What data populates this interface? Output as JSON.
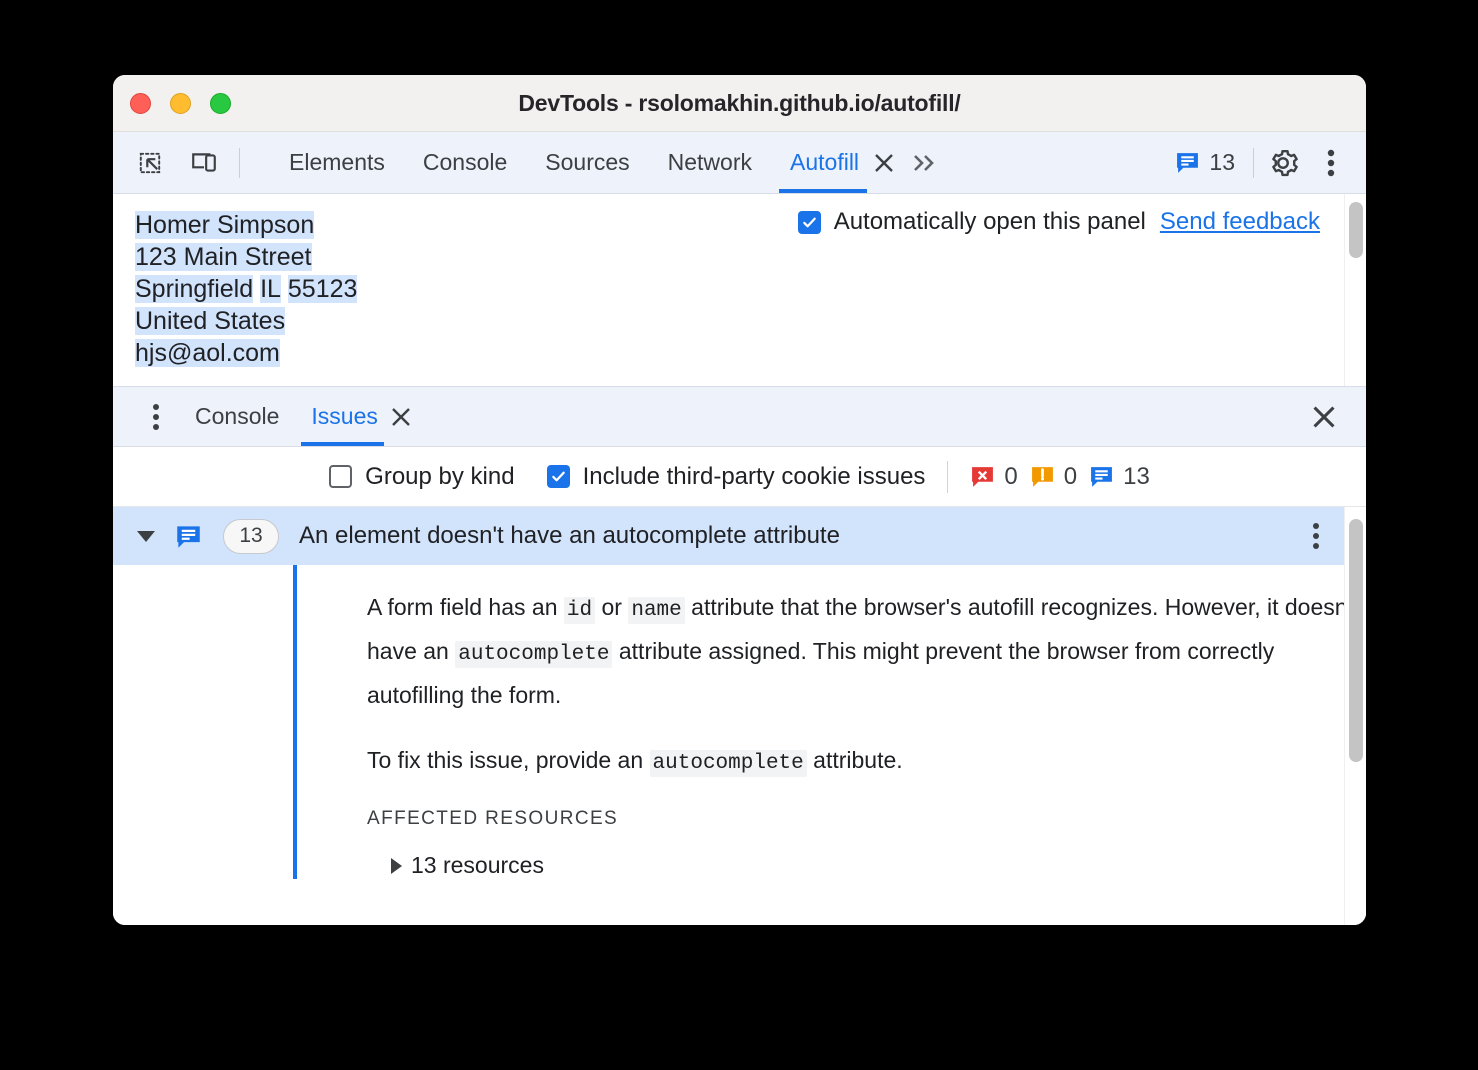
{
  "window": {
    "title": "DevTools - rsolomakhin.github.io/autofill/",
    "traffic_lights": [
      "close",
      "minimize",
      "zoom"
    ],
    "colors": {
      "accent": "#1a73e8",
      "selection": "#d2e3fc",
      "error": "#e53935",
      "warning": "#f29900",
      "info": "#1a73e8",
      "titlebar": "#f2f1ef",
      "toolbar": "#eef2fb"
    }
  },
  "toolbar": {
    "inspect_icon": "inspect-element-icon",
    "device_icon": "device-toolbar-icon",
    "tabs": [
      {
        "label": "Elements",
        "active": false,
        "closable": false
      },
      {
        "label": "Console",
        "active": false,
        "closable": false
      },
      {
        "label": "Sources",
        "active": false,
        "closable": false
      },
      {
        "label": "Network",
        "active": false,
        "closable": false
      },
      {
        "label": "Autofill",
        "active": true,
        "closable": true
      }
    ],
    "overflow_label": "»",
    "issue_count": "13",
    "settings_icon": "gear-icon",
    "more_icon": "more-options-icon"
  },
  "autofill_panel": {
    "address_lines": [
      {
        "text": "Homer Simpson",
        "segments": [
          {
            "text": "Homer Simpson",
            "highlighted": true
          }
        ]
      },
      {
        "text": "123 Main Street",
        "segments": [
          {
            "text": "123 Main Street",
            "highlighted": true
          }
        ]
      },
      {
        "text": "Springfield IL 55123",
        "segments": [
          {
            "text": "Springfield",
            "highlighted": true
          },
          {
            "text": " ",
            "highlighted": false
          },
          {
            "text": "IL",
            "highlighted": true
          },
          {
            "text": " ",
            "highlighted": false
          },
          {
            "text": "55123",
            "highlighted": true
          }
        ]
      },
      {
        "text": "United States",
        "segments": [
          {
            "text": "United States",
            "highlighted": true
          }
        ]
      },
      {
        "text": "hjs@aol.com",
        "segments": [
          {
            "text": "hjs@aol.com",
            "highlighted": true
          }
        ]
      }
    ],
    "auto_open_checkbox": {
      "label": "Automatically open this panel",
      "checked": true
    },
    "feedback_link": "Send feedback"
  },
  "drawer": {
    "menu_icon": "more-options-icon",
    "tabs": [
      {
        "label": "Console",
        "active": false,
        "closable": false
      },
      {
        "label": "Issues",
        "active": true,
        "closable": true
      }
    ],
    "close_icon": "close-icon"
  },
  "issues_toolbar": {
    "group_by_kind": {
      "label": "Group by kind",
      "checked": false
    },
    "third_party_cookies": {
      "label": "Include third-party cookie issues",
      "checked": true
    },
    "counts": [
      {
        "kind": "errors",
        "icon": "error-icon",
        "value": "0",
        "color": "#e53935"
      },
      {
        "kind": "warnings",
        "icon": "warning-icon",
        "value": "0",
        "color": "#f29900"
      },
      {
        "kind": "info",
        "icon": "info-icon",
        "value": "13",
        "color": "#1a73e8"
      }
    ]
  },
  "issue": {
    "expanded": true,
    "icon": "info-icon",
    "count": "13",
    "title": "An element doesn't have an autocomplete attribute",
    "menu_icon": "more-options-icon",
    "paragraph1": {
      "part1": "A form field has an ",
      "code1": "id",
      "part2": " or ",
      "code2": "name",
      "part3": " attribute that the browser's autofill recognizes. However, it doesn't have an ",
      "code3": "autocomplete",
      "part4": " attribute assigned. This might prevent the browser from correctly autofilling the form."
    },
    "paragraph2": {
      "part1": "To fix this issue, provide an ",
      "code1": "autocomplete",
      "part2": " attribute."
    },
    "affected_resources_title": "AFFECTED RESOURCES",
    "resources_label": "13 resources",
    "resources_expanded": false
  }
}
